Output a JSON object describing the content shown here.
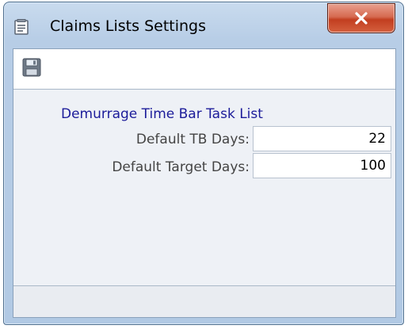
{
  "window": {
    "title": "Claims Lists Settings",
    "title_icon": "document-list-icon",
    "close_icon": "close-icon"
  },
  "toolbar": {
    "save_icon": "save-icon"
  },
  "section": {
    "title": "Demurrage Time Bar Task List"
  },
  "fields": {
    "default_tb_days": {
      "label": "Default TB Days:",
      "value": "22"
    },
    "default_target_days": {
      "label": "Default Target Days:",
      "value": "100"
    }
  },
  "colors": {
    "section_title": "#1c1c9a",
    "close_button": "#c94a2b",
    "window_frame": "#b7cde6"
  }
}
